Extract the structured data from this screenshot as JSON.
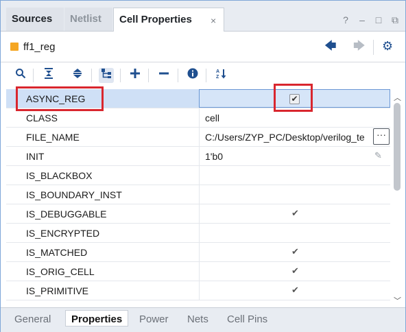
{
  "tabs": [
    {
      "label": "Sources"
    },
    {
      "label": "Netlist"
    },
    {
      "label": "Cell Properties"
    }
  ],
  "tab_close": "×",
  "window_controls": [
    "?",
    "–",
    "□",
    "⧉"
  ],
  "header": {
    "cell_name": "ff1_reg",
    "cell_icon_color": "#f5a623"
  },
  "toolbar": {
    "icons": [
      "search-icon",
      "collapse-all-icon",
      "expand-all-icon",
      "hierarchy-icon",
      "add-icon",
      "remove-icon",
      "info-icon",
      "sort-az-icon"
    ]
  },
  "properties": [
    {
      "name": "ASYNC_REG",
      "value": "",
      "checked": true,
      "selected": true
    },
    {
      "name": "CLASS",
      "value": "cell"
    },
    {
      "name": "FILE_NAME",
      "value": "C:/Users/ZYP_PC/Desktop/verilog_te"
    },
    {
      "name": "INIT",
      "value": "1'b0"
    },
    {
      "name": "IS_BLACKBOX",
      "value": ""
    },
    {
      "name": "IS_BOUNDARY_INST",
      "value": ""
    },
    {
      "name": "IS_DEBUGGABLE",
      "value": "",
      "tick": true
    },
    {
      "name": "IS_ENCRYPTED",
      "value": ""
    },
    {
      "name": "IS_MATCHED",
      "value": "",
      "tick": true
    },
    {
      "name": "IS_ORIG_CELL",
      "value": "",
      "tick": true
    },
    {
      "name": "IS_PRIMITIVE",
      "value": "",
      "tick": true
    }
  ],
  "bottom_tabs": [
    {
      "label": "General"
    },
    {
      "label": "Properties",
      "active": true
    },
    {
      "label": "Power"
    },
    {
      "label": "Nets"
    },
    {
      "label": "Cell Pins"
    }
  ],
  "highlight_color": "#d9262e"
}
